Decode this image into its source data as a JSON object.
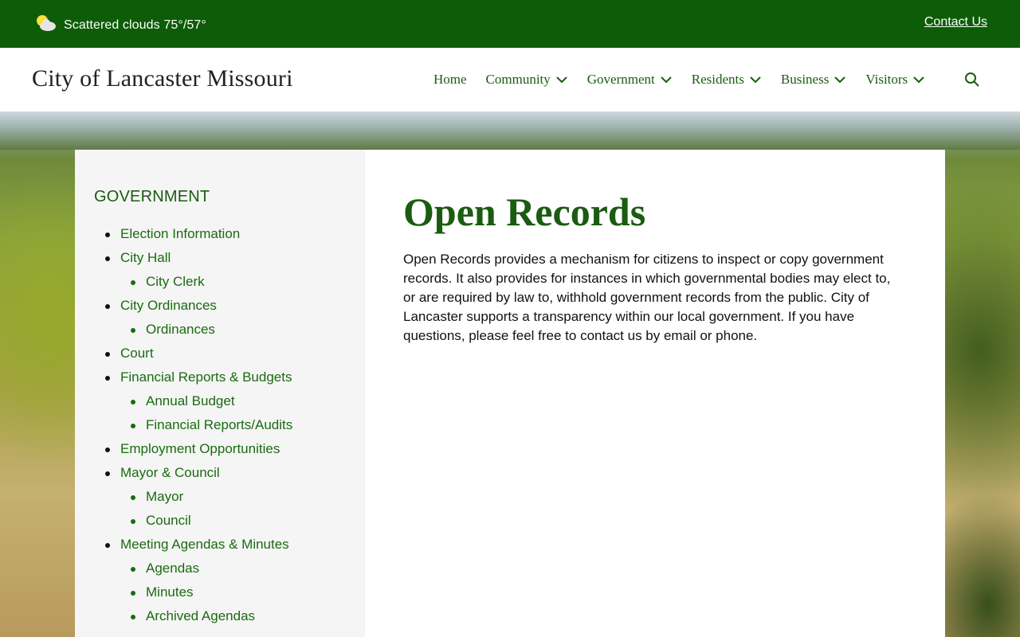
{
  "topbar": {
    "weather": "Scattered clouds 75°/57°",
    "contact_label": "Contact Us",
    "background_color": "#0d5c07"
  },
  "header": {
    "site_title": "City of Lancaster Missouri",
    "nav": [
      {
        "label": "Home",
        "has_dropdown": false
      },
      {
        "label": "Community",
        "has_dropdown": true
      },
      {
        "label": "Government",
        "has_dropdown": true
      },
      {
        "label": "Residents",
        "has_dropdown": true
      },
      {
        "label": "Business",
        "has_dropdown": true
      },
      {
        "label": "Visitors",
        "has_dropdown": true
      }
    ],
    "search_icon": "search-icon"
  },
  "sidebar": {
    "heading": "GOVERNMENT",
    "items": [
      {
        "label": "Election Information",
        "level": 1
      },
      {
        "label": "City Hall",
        "level": 1
      },
      {
        "label": "City Clerk",
        "level": 2
      },
      {
        "label": "City Ordinances",
        "level": 1
      },
      {
        "label": "Ordinances",
        "level": 2
      },
      {
        "label": "Court",
        "level": 1
      },
      {
        "label": "Financial Reports & Budgets",
        "level": 1
      },
      {
        "label": "Annual Budget",
        "level": 2
      },
      {
        "label": "Financial Reports/Audits",
        "level": 2
      },
      {
        "label": "Employment Opportunities",
        "level": 1
      },
      {
        "label": "Mayor & Council",
        "level": 1
      },
      {
        "label": "Mayor",
        "level": 2
      },
      {
        "label": "Council",
        "level": 2
      },
      {
        "label": "Meeting Agendas & Minutes",
        "level": 1
      },
      {
        "label": "Agendas",
        "level": 2
      },
      {
        "label": "Minutes",
        "level": 2
      },
      {
        "label": "Archived Agendas",
        "level": 2
      }
    ]
  },
  "main": {
    "title": "Open Records",
    "body": "Open Records provides a mechanism for citizens to inspect or copy government records. It also provides for instances in which governmental bodies may elect to, or are required by law to, withhold government records from the public. City of Lancaster supports a transparency within our local government. If you have questions, please feel free to contact us by email or phone."
  },
  "colors": {
    "brand_green": "#1a5c10",
    "link_green": "#1a6b10",
    "sidebar_bg": "#f5f5f5"
  }
}
